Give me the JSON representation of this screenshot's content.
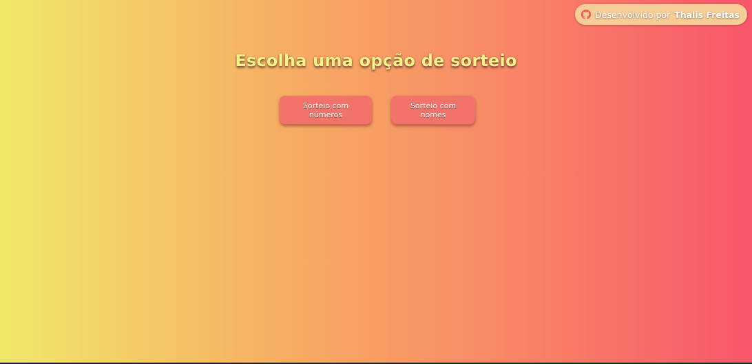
{
  "credit": {
    "icon": "github-icon",
    "prefix": "Desenvolvido por",
    "author": "Thalis Freitas"
  },
  "title": "Escolha uma opção de sorteio",
  "options": {
    "numbers_label": "Sorteio com números",
    "names_label": "Sorteio com nomes"
  },
  "colors": {
    "gradient_start": "#f0e86a",
    "gradient_end": "#f8566a",
    "button": "#f1736a",
    "title": "#fbf08a",
    "credit_bg": "#f6cc97"
  }
}
